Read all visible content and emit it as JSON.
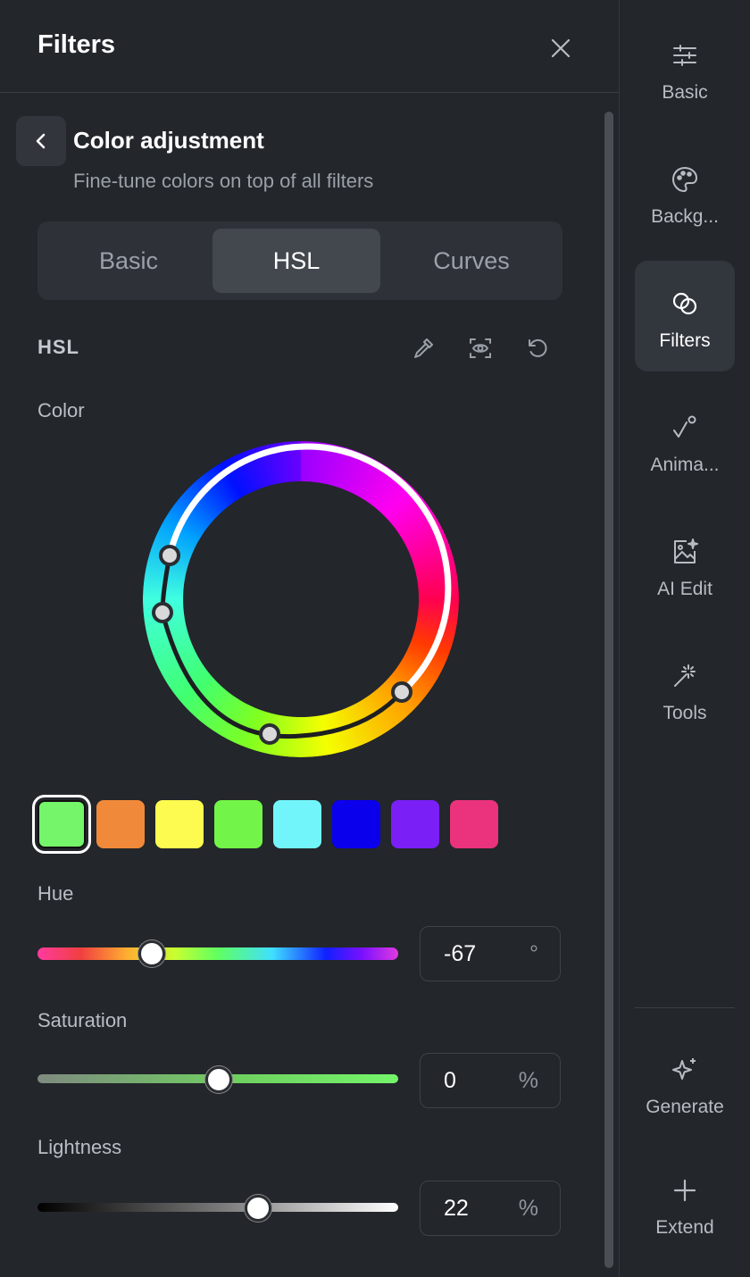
{
  "header": {
    "title": "Filters"
  },
  "section": {
    "title": "Color adjustment",
    "subtitle": "Fine-tune colors on top of all filters"
  },
  "tabs": [
    {
      "label": "Basic"
    },
    {
      "label": "HSL",
      "active": true
    },
    {
      "label": "Curves"
    }
  ],
  "hsl": {
    "label": "HSL",
    "tools": [
      "eyedropper-icon",
      "preview-eye-icon",
      "reset-icon"
    ],
    "color_label": "Color"
  },
  "swatches": [
    {
      "name": "selected-green",
      "color": "#74f56a",
      "selected": true
    },
    {
      "name": "orange",
      "color": "#f08a3a"
    },
    {
      "name": "yellow",
      "color": "#fdfb4f"
    },
    {
      "name": "green",
      "color": "#72f548"
    },
    {
      "name": "cyan",
      "color": "#72f5fa"
    },
    {
      "name": "blue",
      "color": "#0b00ec"
    },
    {
      "name": "purple",
      "color": "#7a1ff5"
    },
    {
      "name": "magenta",
      "color": "#ea337c"
    }
  ],
  "sliders": {
    "hue": {
      "label": "Hue",
      "value": "-67",
      "unit": "°",
      "fraction": 0.315
    },
    "saturation": {
      "label": "Saturation",
      "value": "0",
      "unit": "%",
      "fraction": 0.5
    },
    "lightness": {
      "label": "Lightness",
      "value": "22",
      "unit": "%",
      "fraction": 0.61
    }
  },
  "rail": {
    "items": [
      {
        "label": "Basic",
        "icon": "sliders-icon"
      },
      {
        "label": "Backg...",
        "icon": "palette-icon"
      },
      {
        "label": "Filters",
        "icon": "filters-icon",
        "active": true
      },
      {
        "label": "Anima...",
        "icon": "animation-icon"
      },
      {
        "label": "AI Edit",
        "icon": "ai-edit-icon"
      },
      {
        "label": "Tools",
        "icon": "magic-wand-icon"
      }
    ],
    "bottom": [
      {
        "label": "Generate",
        "icon": "sparkle-icon"
      },
      {
        "label": "Extend",
        "icon": "plus-icon"
      }
    ]
  }
}
